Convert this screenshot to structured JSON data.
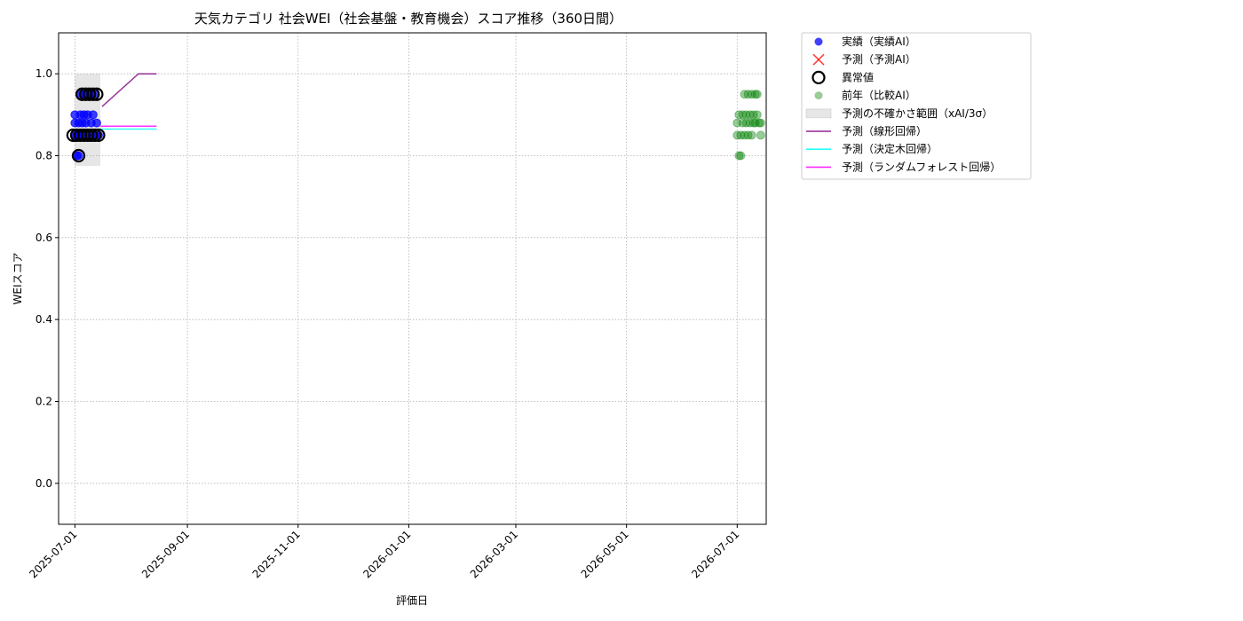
{
  "chart_data": {
    "type": "scatter",
    "title": "天気カテゴリ 社会WEI（社会基盤・教育機会）スコア推移（360日間）",
    "xlabel": "評価日",
    "ylabel": "WEIスコア",
    "xlim": [
      "2025-06-22",
      "2026-07-17"
    ],
    "ylim": [
      -0.1,
      1.1
    ],
    "x_ticks": [
      "2025-07-01",
      "2025-09-01",
      "2025-11-01",
      "2026-01-01",
      "2026-03-01",
      "2026-05-01",
      "2026-07-01"
    ],
    "y_ticks": [
      0.0,
      0.2,
      0.4,
      0.6,
      0.8,
      1.0
    ],
    "grid": true,
    "legend_position": "outside upper right",
    "legend": [
      "実績（実績AI）",
      "予測（予測AI）",
      "異常値",
      "前年（比較AI）",
      "予測の不確かさ範囲（xAI/3σ）",
      "予測（線形回帰）",
      "予測（決定木回帰）",
      "予測（ランダムフォレスト回帰）"
    ],
    "series": [
      {
        "name": "実績（実績AI）",
        "kind": "scatter",
        "color": "#0000ff",
        "points": [
          [
            "2025-07-01",
            0.85
          ],
          [
            "2025-07-01",
            0.88
          ],
          [
            "2025-07-01",
            0.9
          ],
          [
            "2025-07-02",
            0.85
          ],
          [
            "2025-07-02",
            0.8
          ],
          [
            "2025-07-03",
            0.88
          ],
          [
            "2025-07-03",
            0.85
          ],
          [
            "2025-07-03",
            0.8
          ],
          [
            "2025-07-04",
            0.95
          ],
          [
            "2025-07-04",
            0.9
          ],
          [
            "2025-07-05",
            0.85
          ],
          [
            "2025-07-05",
            0.88
          ],
          [
            "2025-07-06",
            0.95
          ],
          [
            "2025-07-06",
            0.9
          ],
          [
            "2025-07-07",
            0.85
          ],
          [
            "2025-07-07",
            0.88
          ],
          [
            "2025-07-08",
            0.95
          ],
          [
            "2025-07-08",
            0.9
          ],
          [
            "2025-07-09",
            0.85
          ],
          [
            "2025-07-10",
            0.95
          ],
          [
            "2025-07-10",
            0.88
          ],
          [
            "2025-07-11",
            0.9
          ],
          [
            "2025-07-12",
            0.95
          ],
          [
            "2025-07-12",
            0.85
          ],
          [
            "2025-07-13",
            0.88
          ],
          [
            "2025-07-14",
            0.85
          ]
        ]
      },
      {
        "name": "異常値",
        "kind": "outlier",
        "color": "#000000",
        "points": [
          [
            "2025-06-30",
            0.85
          ],
          [
            "2025-07-02",
            0.85
          ],
          [
            "2025-07-03",
            0.8
          ],
          [
            "2025-07-04",
            0.85
          ],
          [
            "2025-07-05",
            0.95
          ],
          [
            "2025-07-06",
            0.85
          ],
          [
            "2025-07-07",
            0.95
          ],
          [
            "2025-07-08",
            0.85
          ],
          [
            "2025-07-09",
            0.95
          ],
          [
            "2025-07-10",
            0.85
          ],
          [
            "2025-07-11",
            0.95
          ],
          [
            "2025-07-12",
            0.85
          ],
          [
            "2025-07-13",
            0.95
          ],
          [
            "2025-07-14",
            0.85
          ]
        ]
      },
      {
        "name": "前年（比較AI）",
        "kind": "scatter",
        "color": "#008000",
        "points": [
          [
            "2026-07-01",
            0.85
          ],
          [
            "2026-07-01",
            0.88
          ],
          [
            "2026-07-02",
            0.9
          ],
          [
            "2026-07-02",
            0.8
          ],
          [
            "2026-07-03",
            0.85
          ],
          [
            "2026-07-03",
            0.8
          ],
          [
            "2026-07-04",
            0.88
          ],
          [
            "2026-07-04",
            0.9
          ],
          [
            "2026-07-05",
            0.85
          ],
          [
            "2026-07-05",
            0.95
          ],
          [
            "2026-07-06",
            0.88
          ],
          [
            "2026-07-06",
            0.9
          ],
          [
            "2026-07-07",
            0.85
          ],
          [
            "2026-07-07",
            0.95
          ],
          [
            "2026-07-08",
            0.9
          ],
          [
            "2026-07-08",
            0.88
          ],
          [
            "2026-07-09",
            0.95
          ],
          [
            "2026-07-09",
            0.85
          ],
          [
            "2026-07-10",
            0.9
          ],
          [
            "2026-07-10",
            0.88
          ],
          [
            "2026-07-11",
            0.95
          ],
          [
            "2026-07-11",
            0.88
          ],
          [
            "2026-07-12",
            0.9
          ],
          [
            "2026-07-12",
            0.95
          ],
          [
            "2026-07-13",
            0.88
          ],
          [
            "2026-07-14",
            0.85
          ],
          [
            "2026-07-14",
            0.88
          ]
        ]
      },
      {
        "name": "予測の不確かさ範囲（xAI/3σ）",
        "kind": "band",
        "color": "#808080",
        "x_range": [
          "2025-07-01",
          "2025-07-15"
        ],
        "y_range": [
          0.775,
          1.0
        ]
      },
      {
        "name": "予測（線形回帰）",
        "kind": "line",
        "color": "#800080",
        "points": [
          [
            "2025-07-16",
            0.92
          ],
          [
            "2025-08-05",
            1.0
          ],
          [
            "2025-08-15",
            1.0
          ]
        ]
      },
      {
        "name": "予測（決定木回帰）",
        "kind": "line",
        "color": "#00ffff",
        "points": [
          [
            "2025-07-15",
            0.865
          ],
          [
            "2025-08-15",
            0.865
          ]
        ]
      },
      {
        "name": "予測（ランダムフォレスト回帰）",
        "kind": "line",
        "color": "#ff00ff",
        "points": [
          [
            "2025-07-15",
            0.872
          ],
          [
            "2025-08-15",
            0.872
          ]
        ]
      }
    ]
  }
}
